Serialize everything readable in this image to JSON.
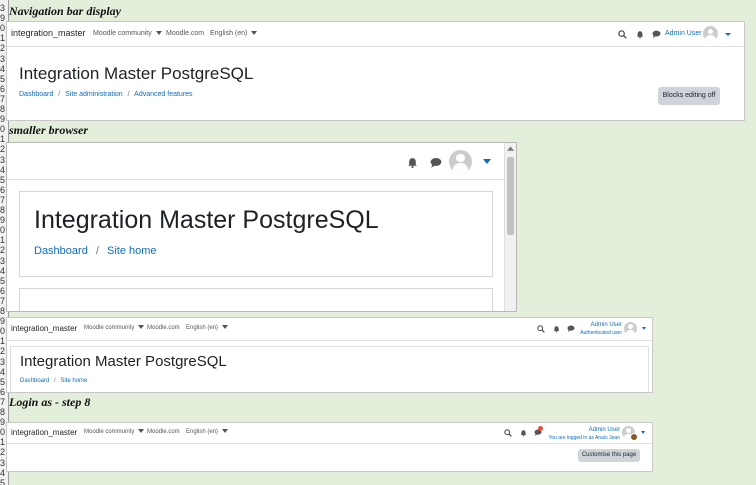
{
  "row_numbers": [
    "3",
    "9",
    "0",
    "1",
    "2",
    "3",
    "4",
    "5",
    "6",
    "7",
    "8",
    "9",
    "0",
    "1",
    "2",
    "3",
    "4",
    "5",
    "6",
    "7",
    "8",
    "9",
    "0",
    "1",
    "2",
    "3",
    "4",
    "5",
    "6",
    "7",
    "8",
    "9",
    "0",
    "1",
    "2",
    "3",
    "4",
    "5",
    "6",
    "7",
    "8",
    "9",
    "0",
    "1",
    "2",
    "3",
    "4",
    "5"
  ],
  "captions": {
    "nav_bar_display": "Navigation bar display",
    "smaller_browser": "smaller browser",
    "login_as_step8": "Login as - step 8"
  },
  "shot1": {
    "site_name": "integration_master",
    "menu": [
      {
        "label": "Moodle community",
        "dropdown": true
      },
      {
        "label": "Moodle.com",
        "dropdown": false
      },
      {
        "label": "English (en)",
        "dropdown": true
      }
    ],
    "user_name": "Admin User",
    "page_title": "Integration Master PostgreSQL",
    "breadcrumb": [
      "Dashboard",
      "Site administration",
      "Advanced features"
    ],
    "breadcrumb_sep": "/",
    "blocks_button": "Blocks editing off"
  },
  "shot2": {
    "page_title": "Integration Master PostgreSQL",
    "breadcrumb": [
      "Dashboard",
      "Site home"
    ],
    "breadcrumb_sep": "/"
  },
  "shot3": {
    "site_name": "integration_master",
    "menu": [
      {
        "label": "Moodle community",
        "dropdown": true
      },
      {
        "label": "Moodle.com",
        "dropdown": false
      },
      {
        "label": "English (en)",
        "dropdown": true
      }
    ],
    "user_name": "Admin User",
    "user_role": "Authenticated user",
    "page_title": "Integration Master PostgreSQL",
    "breadcrumb": [
      "Dashboard",
      "Site home"
    ],
    "breadcrumb_sep": "/"
  },
  "shot4": {
    "site_name": "integration_master",
    "menu": [
      {
        "label": "Moodle community",
        "dropdown": true
      },
      {
        "label": "Moodle.com",
        "dropdown": false
      },
      {
        "label": "English (en)",
        "dropdown": true
      }
    ],
    "user_name": "Admin User",
    "logged_in_as": "You are logged in as Anaïs Jean",
    "customise_button": "Customise this page"
  },
  "colors": {
    "link": "#0f6cbf",
    "background": "#e3efdb",
    "notification_badge": "#e74c3c"
  },
  "icons": [
    "search-icon",
    "bell-icon",
    "chat-icon",
    "avatar-icon",
    "chevron-down-icon"
  ]
}
